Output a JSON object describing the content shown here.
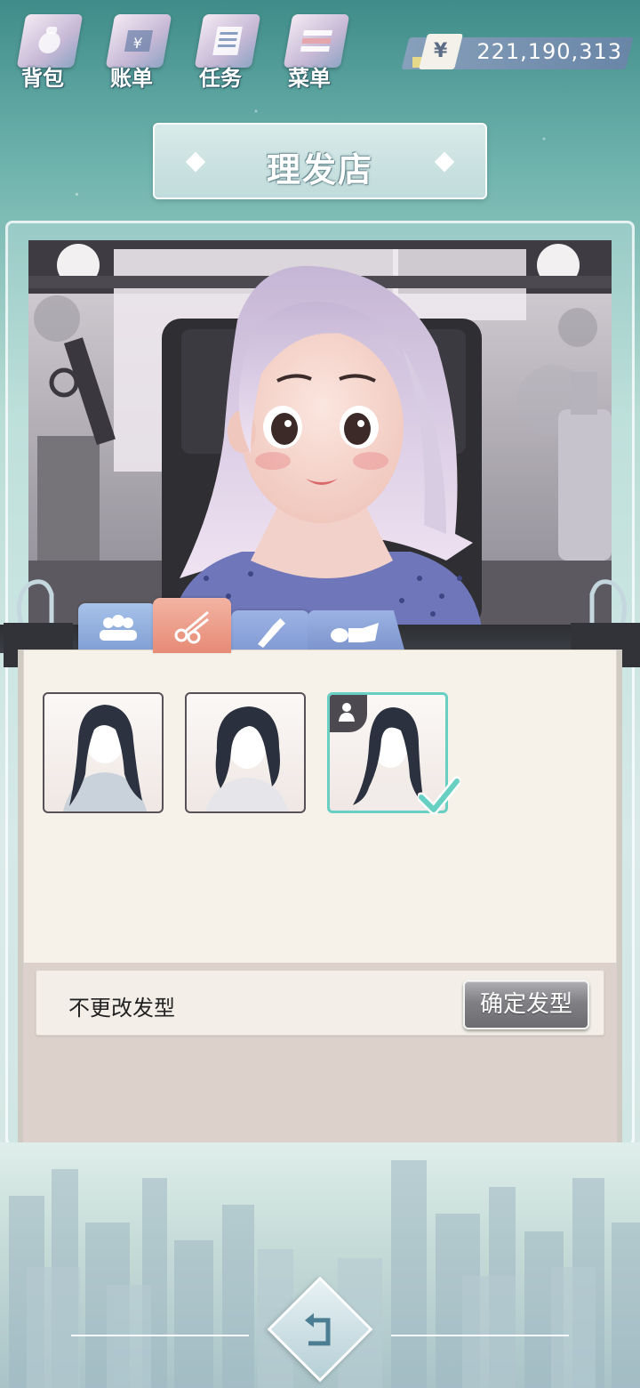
{
  "top_menu": [
    {
      "label": "背包",
      "icon": "backpack-icon"
    },
    {
      "label": "账单",
      "icon": "bill-icon"
    },
    {
      "label": "任务",
      "icon": "task-list-icon"
    },
    {
      "label": "菜单",
      "icon": "menu-icon"
    }
  ],
  "money": {
    "symbol": "¥",
    "value": "221,190,313"
  },
  "title": "理发店",
  "tabs": [
    {
      "icon": "people-icon",
      "state": "inactive"
    },
    {
      "icon": "scissors-icon",
      "state": "active"
    },
    {
      "icon": "cosmetics-icon",
      "state": "inactive"
    },
    {
      "icon": "accessories-icon",
      "state": "inactive"
    }
  ],
  "hairstyles": [
    {
      "style": "long-wavy",
      "selected": false
    },
    {
      "style": "medium-wavy",
      "selected": false
    },
    {
      "style": "long-side-swept",
      "selected": true,
      "badge": "person-icon"
    }
  ],
  "action_bar": {
    "no_change_label": "不更改发型",
    "confirm_label": "确定发型"
  },
  "colors": {
    "accent_selected": "#67d0c2",
    "tab_active": "#e68b76",
    "tab_inactive": "#8099d2"
  }
}
